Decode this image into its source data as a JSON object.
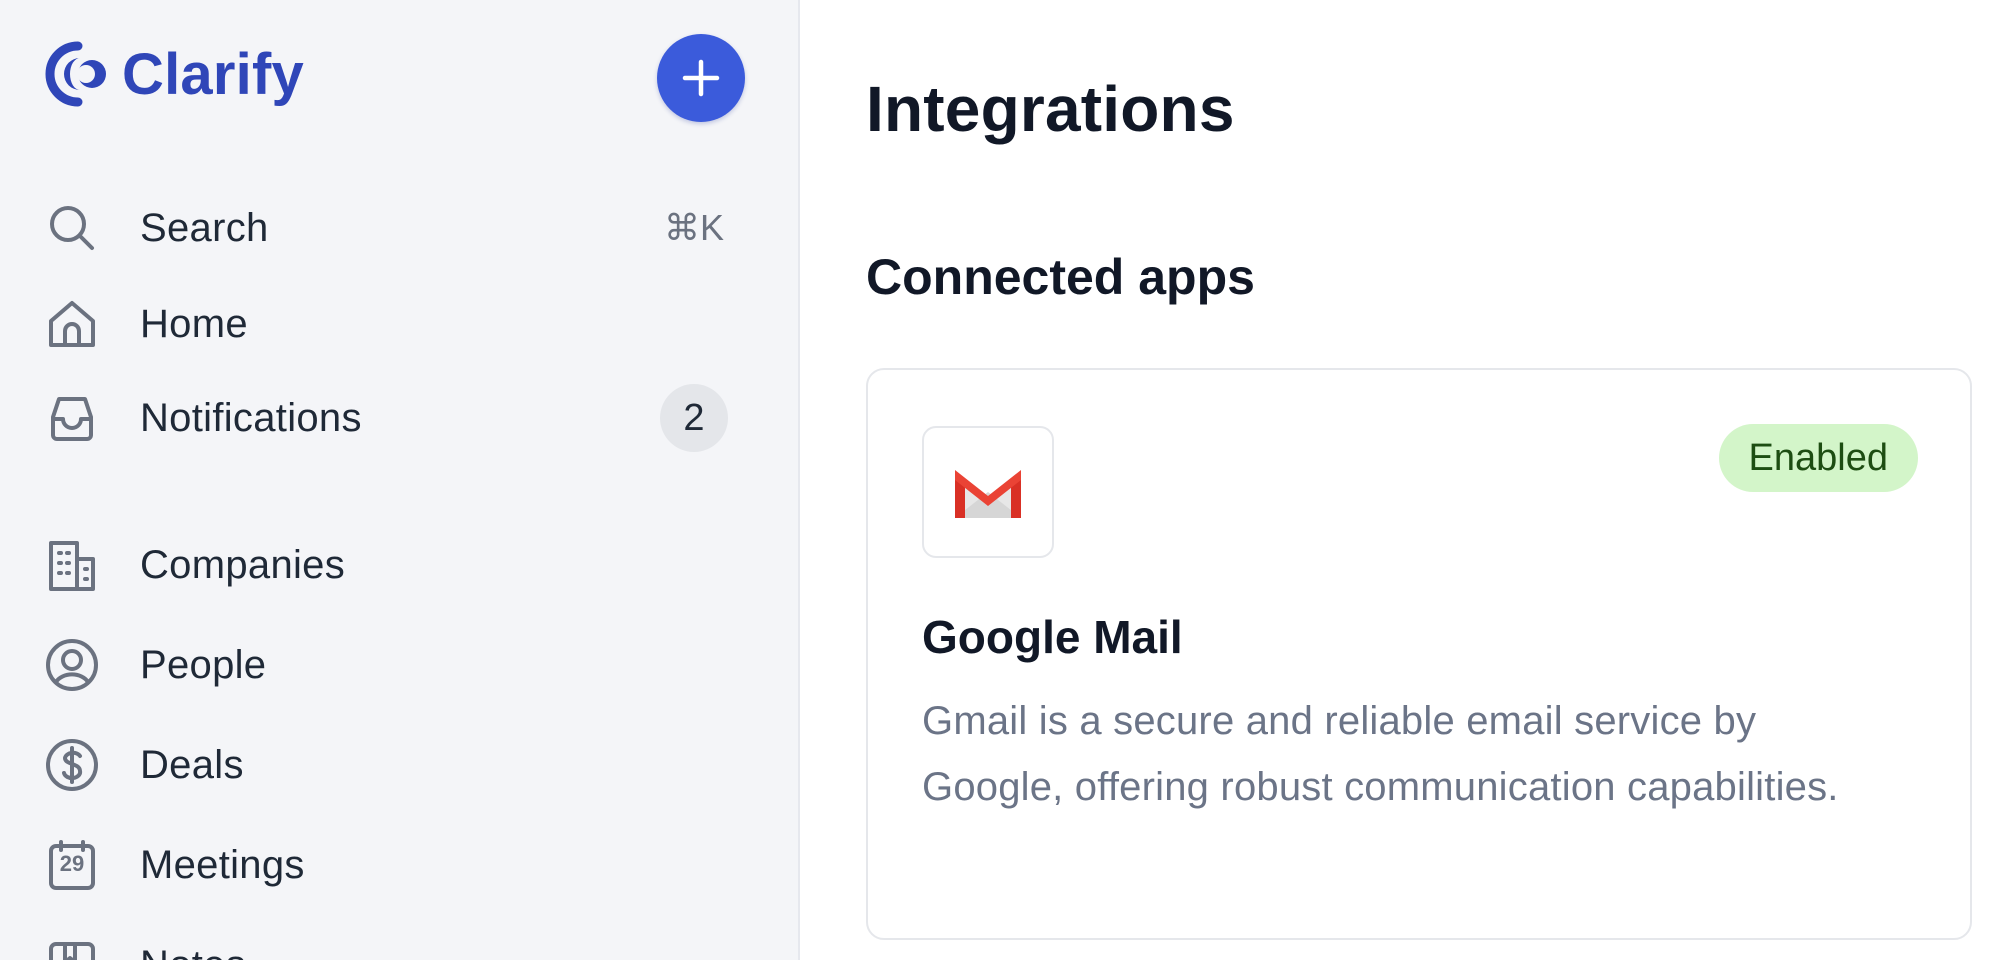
{
  "brand": {
    "name": "Clarify"
  },
  "sidebar": {
    "new_button_icon": "plus-icon",
    "items": [
      {
        "label": "Search",
        "icon": "search-icon",
        "shortcut": "⌘K"
      },
      {
        "label": "Home",
        "icon": "home-icon"
      },
      {
        "label": "Notifications",
        "icon": "inbox-icon",
        "badge": "2"
      },
      {
        "label": "Companies",
        "icon": "building-icon"
      },
      {
        "label": "People",
        "icon": "user-circle-icon"
      },
      {
        "label": "Deals",
        "icon": "dollar-circle-icon"
      },
      {
        "label": "Meetings",
        "icon": "calendar-icon",
        "icon_text": "29"
      },
      {
        "label": "Notes",
        "icon": "note-icon"
      }
    ]
  },
  "main": {
    "title": "Integrations",
    "section_title": "Connected apps",
    "apps": [
      {
        "name": "Google Mail",
        "description": "Gmail is a secure and reliable email service by Google, offering robust communication capabilities.",
        "status": "Enabled",
        "logo": "gmail-icon"
      }
    ]
  },
  "colors": {
    "brand": "#2f46b8",
    "accent_button": "#3b5bdb",
    "status_enabled_bg": "#d3f5c9",
    "status_enabled_text": "#1d4d12",
    "sidebar_bg": "#f4f5f8"
  }
}
